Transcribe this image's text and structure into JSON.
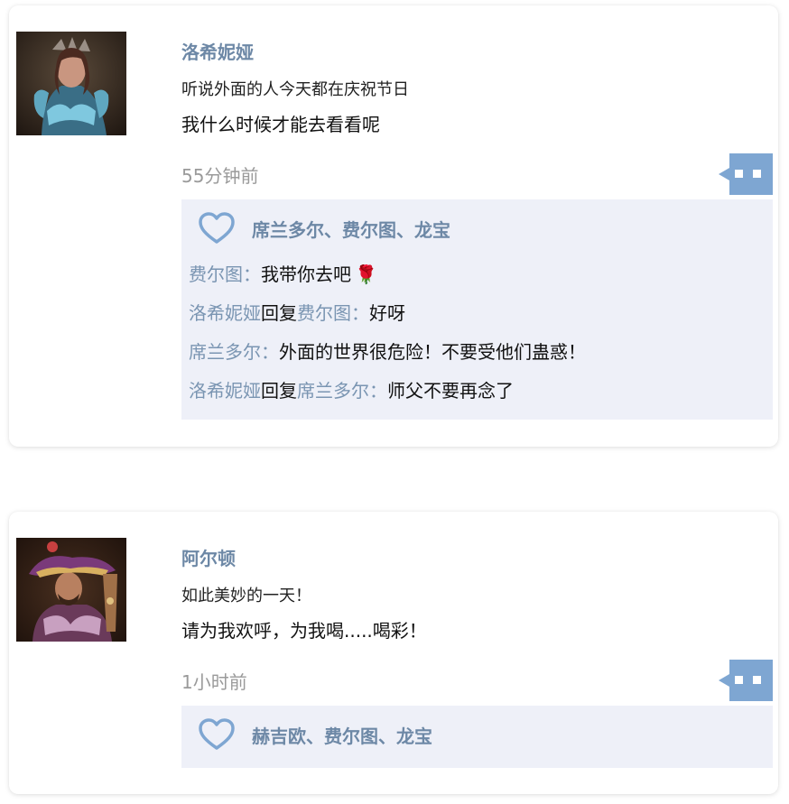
{
  "posts": [
    {
      "author": "洛希妮娅",
      "line1": "听说外面的人今天都在庆祝节日",
      "line2": "我什么时候才能去看看呢",
      "time": "55分钟前",
      "likes": "席兰多尔、费尔图、龙宝",
      "replies": [
        {
          "from": "费尔图",
          "sep": "：",
          "text": "我带你去吧",
          "emoji": "🌹"
        },
        {
          "from": "洛希妮娅",
          "reply_word": "回复",
          "to": "费尔图",
          "sep": "：",
          "text": "好呀"
        },
        {
          "from": "席兰多尔",
          "sep": "：",
          "text": "外面的世界很危险！不要受他们蛊惑！"
        },
        {
          "from": "洛希妮娅",
          "reply_word": "回复",
          "to": "席兰多尔",
          "sep": "：",
          "text": "师父不要再念了"
        }
      ]
    },
    {
      "author": "阿尔顿",
      "line1": "如此美妙的一天！",
      "line2": "请为我欢呼，为我喝.....喝彩！",
      "time": "1小时前",
      "likes": "赫吉欧、费尔图、龙宝"
    }
  ],
  "icons": {
    "heart": "heart-outline-icon",
    "comment": "comment-bubble-icon"
  },
  "colors": {
    "name": "#6d88a6",
    "reply_bg": "#eef0f8",
    "accent": "#7ea6d2"
  }
}
